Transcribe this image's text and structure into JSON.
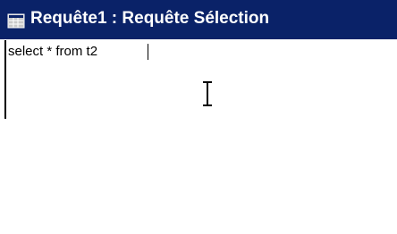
{
  "window": {
    "title": "Requête1 : Requête Sélection",
    "icon": "query-grid-icon",
    "title_bar_color": "#0a2268"
  },
  "editor": {
    "sql_text": "select * from t2",
    "cursor": "i-beam"
  }
}
